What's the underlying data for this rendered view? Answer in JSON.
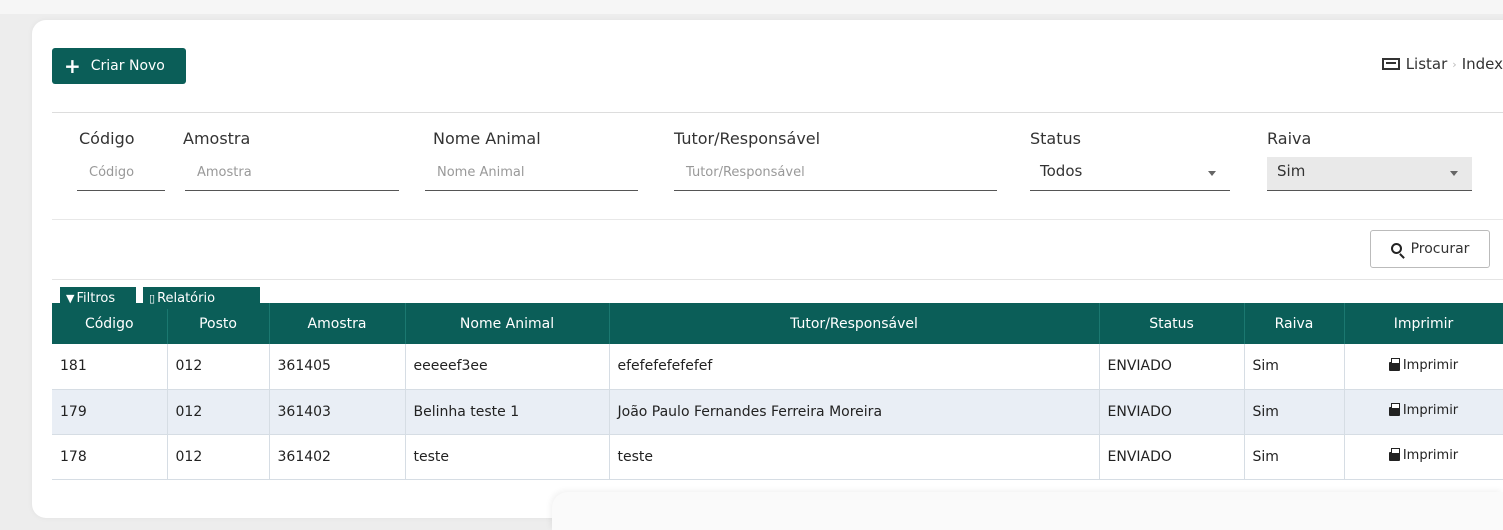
{
  "toolbar": {
    "create_label": "Criar Novo"
  },
  "breadcrumb": {
    "icon": "list-icon",
    "items": [
      "Listar",
      "Index"
    ],
    "separator": "›"
  },
  "filters": {
    "codigo": {
      "label": "Código",
      "placeholder": "Código"
    },
    "amostra": {
      "label": "Amostra",
      "placeholder": "Amostra"
    },
    "nome_animal": {
      "label": "Nome Animal",
      "placeholder": "Nome Animal"
    },
    "tutor": {
      "label": "Tutor/Responsável",
      "placeholder": "Tutor/Responsável"
    },
    "status": {
      "label": "Status",
      "selected": "Todos"
    },
    "raiva": {
      "label": "Raiva",
      "selected": "Sim"
    },
    "search_label": "Procurar"
  },
  "tabs": {
    "filtros": "Filtros",
    "relatorio": "Relatório"
  },
  "table": {
    "columns": [
      "Código",
      "Posto",
      "Amostra",
      "Nome Animal",
      "Tutor/Responsável",
      "Status",
      "Raiva",
      "Imprimir"
    ],
    "print_label": "Imprimir",
    "rows": [
      {
        "codigo": "181",
        "posto": "012",
        "amostra": "361405",
        "nome_animal": "eeeeef3ee",
        "tutor": "efefefefefefef",
        "status": "ENVIADO",
        "raiva": "Sim"
      },
      {
        "codigo": "179",
        "posto": "012",
        "amostra": "361403",
        "nome_animal": "Belinha teste 1",
        "tutor": "João Paulo Fernandes Ferreira Moreira",
        "status": "ENVIADO",
        "raiva": "Sim"
      },
      {
        "codigo": "178",
        "posto": "012",
        "amostra": "361402",
        "nome_animal": "teste",
        "tutor": "teste",
        "status": "ENVIADO",
        "raiva": "Sim"
      }
    ]
  },
  "colors": {
    "primary": "#0b5e58",
    "row_alt": "#e9eef5",
    "background": "#ededed"
  }
}
